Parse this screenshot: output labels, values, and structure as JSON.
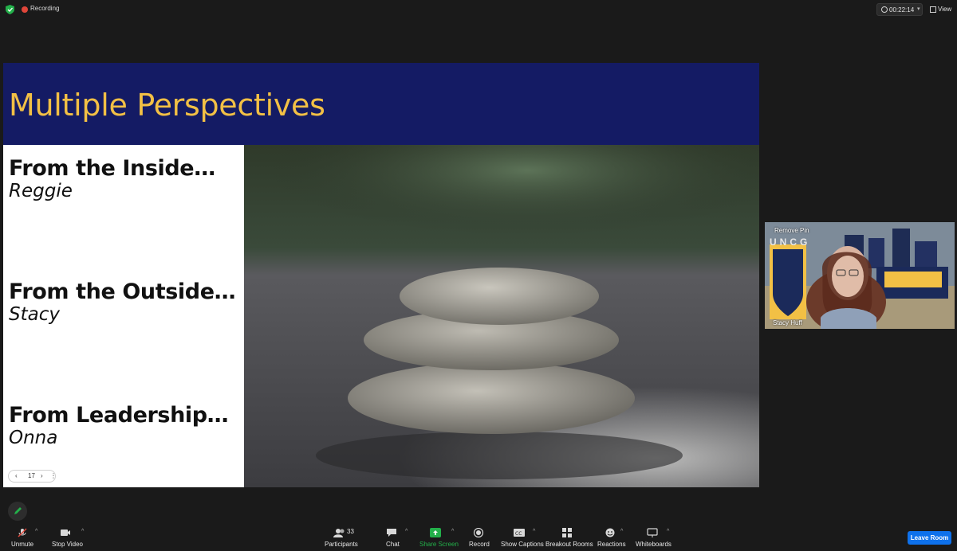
{
  "top_bar": {
    "recording_label": "Recording",
    "timer": "00:22:14",
    "view_label": "View"
  },
  "slide": {
    "title": "Multiple Perspectives",
    "perspectives": [
      {
        "heading": "From the Inside…",
        "name": "Reggie"
      },
      {
        "heading": "From the Outside…",
        "name": "Stacy"
      },
      {
        "heading": "From Leadership…",
        "name": "Onna"
      }
    ],
    "page_number": "17"
  },
  "video_tile": {
    "pin_label": "Remove Pin",
    "participant_name": "Stacy Huff",
    "background_text": "UNCG"
  },
  "toolbar": {
    "unmute": "Unmute",
    "stop_video": "Stop Video",
    "participants": "Participants",
    "participants_count": "33",
    "chat": "Chat",
    "share_screen": "Share Screen",
    "record": "Record",
    "show_captions": "Show Captions",
    "breakout_rooms": "Breakout Rooms",
    "reactions": "Reactions",
    "whiteboards": "Whiteboards",
    "leave_room": "Leave Room"
  },
  "colors": {
    "slide_header_bg": "#141b64",
    "slide_title": "#f2c045",
    "share_green": "#23b04a",
    "leave_blue": "#0e71eb",
    "recording_red": "#e0463a"
  }
}
